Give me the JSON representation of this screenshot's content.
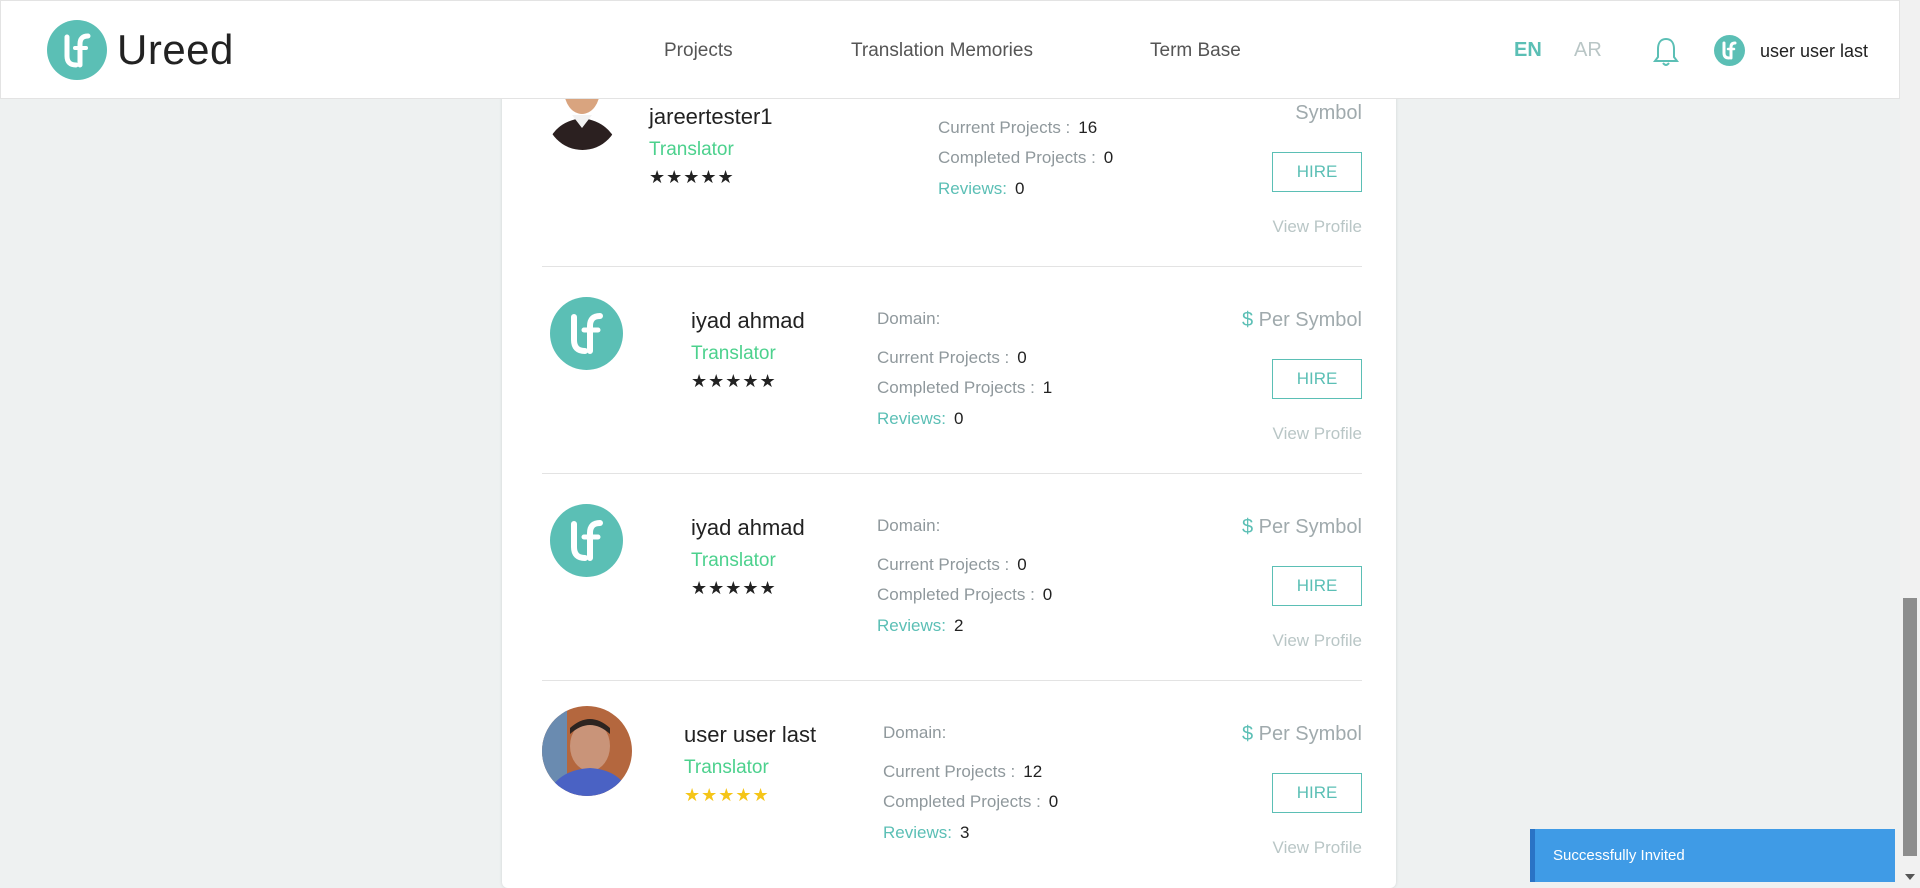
{
  "header": {
    "logo_text": "Ureed",
    "nav": [
      "Projects",
      "Translation Memories",
      "Term Base"
    ],
    "lang_en": "EN",
    "lang_ar": "AR",
    "user_name": "user user last"
  },
  "translators": [
    {
      "name": "jareertester1",
      "role": "Translator",
      "stars": "★★★★★",
      "price_suffix": "Symbol",
      "current_label": "Current Projects :",
      "current_value": "16",
      "completed_label": "Completed Projects :",
      "completed_value": "0",
      "reviews_label": "Reviews:",
      "reviews_value": "0",
      "hire": "HIRE",
      "view_profile": "View Profile"
    },
    {
      "name": "iyad ahmad",
      "role": "Translator",
      "stars": "★★★★★",
      "domain_label": "Domain:",
      "price_prefix": "$",
      "price_suffix": "Per Symbol",
      "current_label": "Current Projects :",
      "current_value": "0",
      "completed_label": "Completed Projects :",
      "completed_value": "1",
      "reviews_label": "Reviews:",
      "reviews_value": "0",
      "hire": "HIRE",
      "view_profile": "View Profile"
    },
    {
      "name": "iyad ahmad",
      "role": "Translator",
      "stars": "★★★★★",
      "domain_label": "Domain:",
      "price_prefix": "$",
      "price_suffix": "Per Symbol",
      "current_label": "Current Projects :",
      "current_value": "0",
      "completed_label": "Completed Projects :",
      "completed_value": "0",
      "reviews_label": "Reviews:",
      "reviews_value": "2",
      "hire": "HIRE",
      "view_profile": "View Profile"
    },
    {
      "name": "user user last",
      "role": "Translator",
      "stars": "★★★★★",
      "domain_label": "Domain:",
      "price_prefix": "$",
      "price_suffix": "Per Symbol",
      "current_label": "Current Projects :",
      "current_value": "12",
      "completed_label": "Completed Projects :",
      "completed_value": "0",
      "reviews_label": "Reviews:",
      "reviews_value": "3",
      "hire": "HIRE",
      "view_profile": "View Profile"
    }
  ],
  "toast": {
    "message": "Successfully Invited"
  },
  "colors": {
    "accent": "#5bbfb5",
    "role_green": "#4cd18d",
    "toast_blue": "#3f9be6",
    "star_gold": "#f5c518"
  },
  "icons": {
    "logo": "ureed-logo-icon",
    "bell": "bell-icon",
    "user": "user-avatar-icon"
  }
}
